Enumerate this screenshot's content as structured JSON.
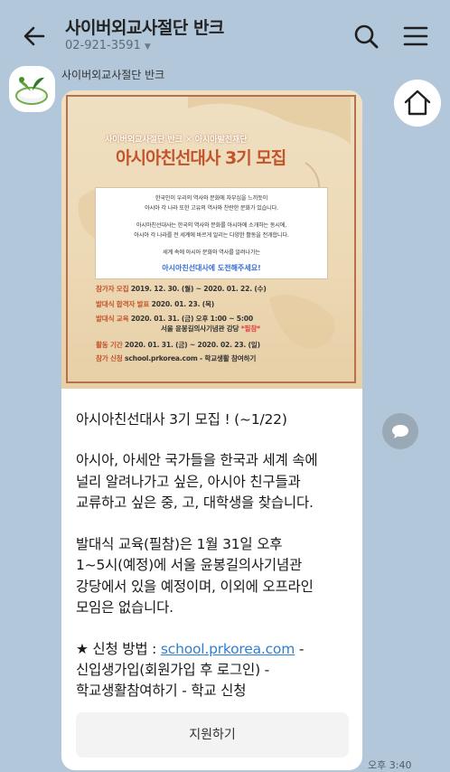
{
  "header": {
    "title": "사이버외교사절단 반크",
    "subtitle": "02-921-3591",
    "caret": "▼"
  },
  "sender": {
    "name": "사이버외교사절단 반크"
  },
  "poster": {
    "org": "사이버외교사절단 반크 ✕ 아시아발전재단",
    "title": "아시아친선대사 3기 모집",
    "box_lines": [
      "한국인이 우리의 역사와 문화에 자부심을 느끼듯이",
      "아시아 각 나라 또한 고유의 역사와 찬란한 문화가 있습니다.",
      "아시아친선대사는 한국의 역사와 문화를 아시아에 소개하는 동시에,",
      "아시아 각 나라를 전 세계에 바르게 알리는 다양한 활동을 전개합니다.",
      "세계 속에 아시아 문화와 역사를 알려나가는",
      "아시아친선대사에 도전해주세요!"
    ],
    "details": [
      {
        "key": "참가자 모집",
        "value": "2019. 12. 30. (월) ~ 2020. 01. 22. (수)"
      },
      {
        "key": "발대식 합격자 발표",
        "value": "2020. 01. 23. (목)"
      },
      {
        "key": "발대식 교육",
        "value": "2020. 01. 31. (금) 오후 1:00 ~ 5:00"
      },
      {
        "key": "",
        "value": "서울 윤봉길의사기념관 강당",
        "extra": "*필참*"
      },
      {
        "key": "활동 기간",
        "value": "2020. 01. 31. (금) ~ 2020. 02. 23. (일)"
      },
      {
        "key": "참가 신청",
        "value": "school.prkorea.com - 학교생활 참여하기"
      }
    ]
  },
  "message": {
    "line1": "아시아친선대사 3기 모집 ! (~1/22)",
    "line2": "아시아, 아세안 국가들을 한국과 세계 속에",
    "line3": "널리 알려나가고 싶은, 아시아 친구들과",
    "line4": "교류하고 싶은 중, 고, 대학생을 찾습니다.",
    "line5": "발대식 교육(필참)은 1월 31일 오후",
    "line6": "1~5시(예정)에 서울 윤봉길의사기념관",
    "line7": "강당에서 있을 예정이며, 이외에 오프라인",
    "line8": "모임은 없습니다.",
    "line9_prefix": "★ 신청 방법 : ",
    "line9_link": "school.prkorea.com",
    "line9_suffix": " -",
    "line10": "신입생가입(회원가입 후 로그인) -",
    "line11": "학교생활참여하기 - 학교 신청"
  },
  "apply_button": {
    "label": "지원하기"
  },
  "timestamp": "오후 3:40",
  "icons": {
    "back": "back-arrow-icon",
    "search": "search-icon",
    "menu": "hamburger-menu-icon",
    "home": "home-icon",
    "share": "share-icon"
  },
  "colors": {
    "background": "#b2c7da",
    "poster_accent": "#c3532a",
    "link": "#2f7fd1"
  }
}
